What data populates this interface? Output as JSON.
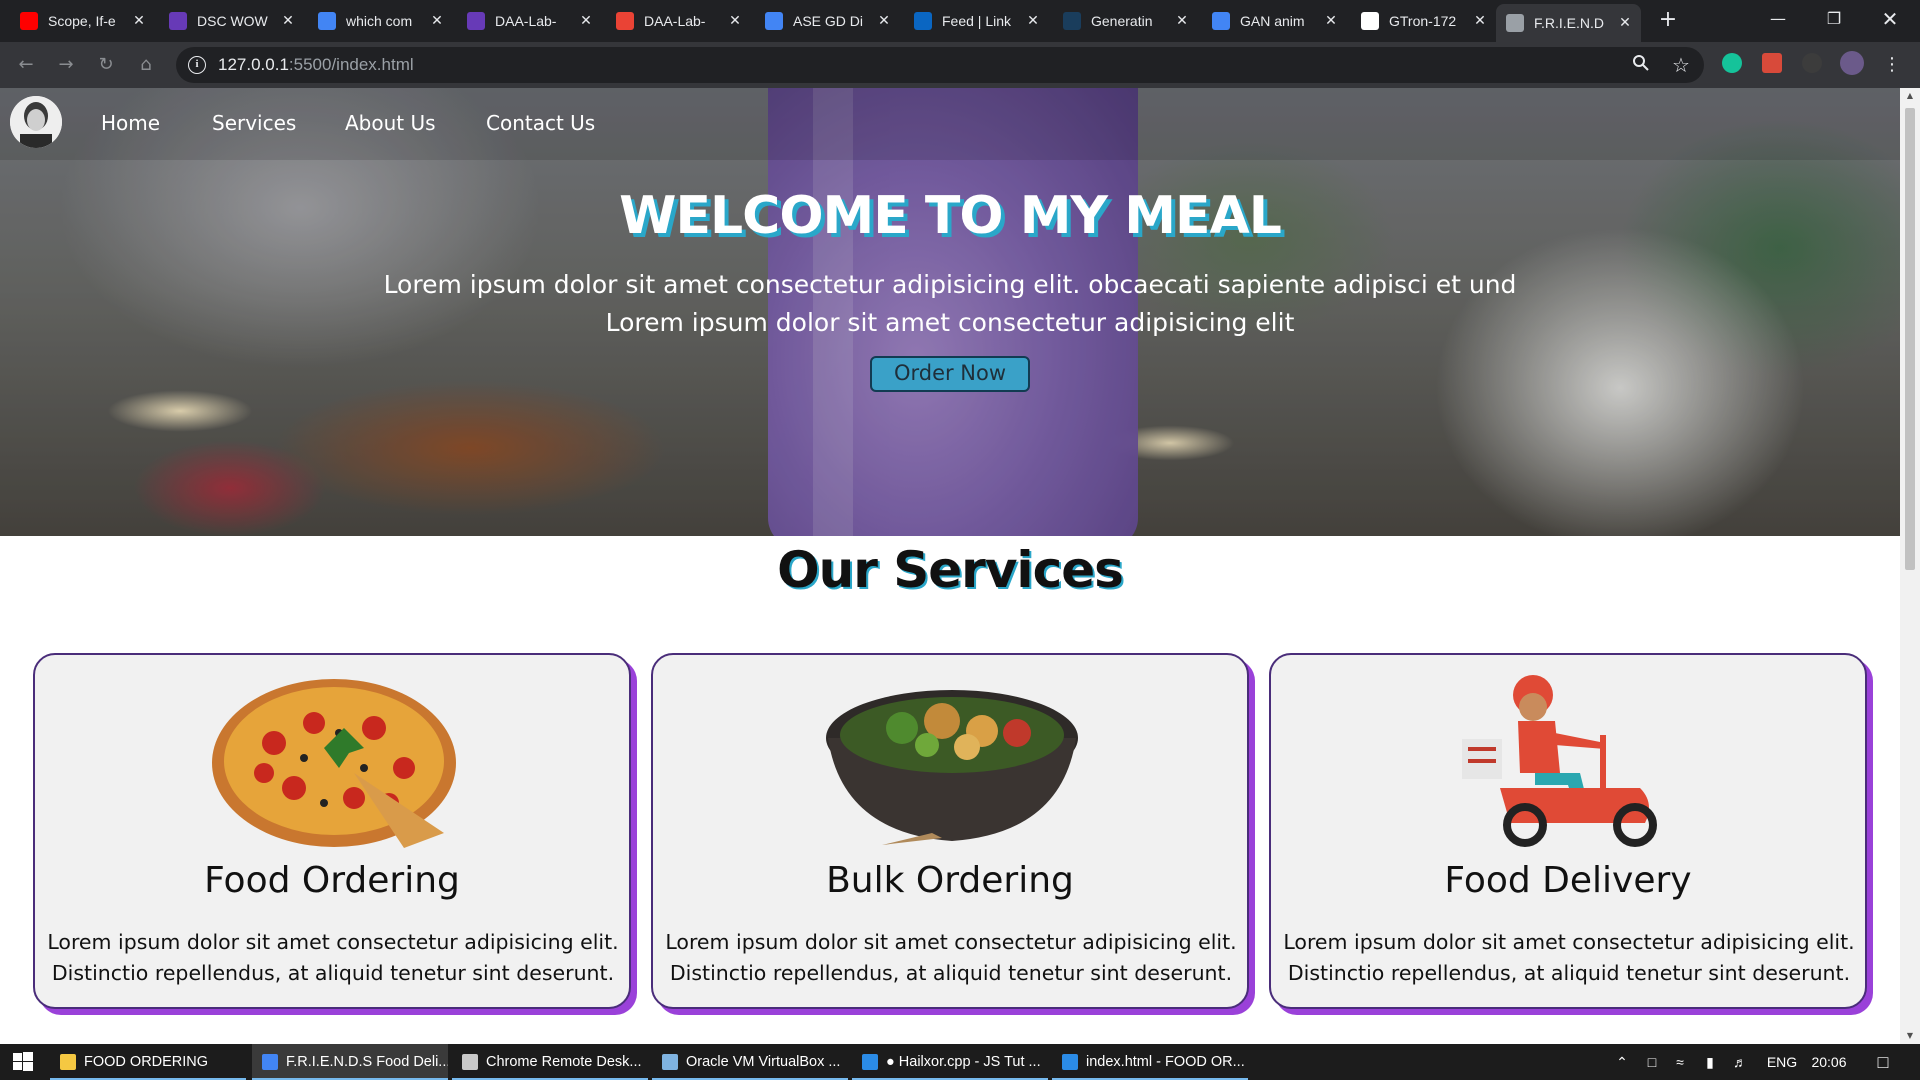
{
  "browser": {
    "tabs": [
      {
        "label": "Scope, If-e",
        "icon": "youtube-icon",
        "color": "#ff0000"
      },
      {
        "label": "DSC WOW",
        "icon": "forms-icon",
        "color": "#673ab7"
      },
      {
        "label": "which com",
        "icon": "google-icon",
        "color": "#4285f4"
      },
      {
        "label": "DAA-Lab-",
        "icon": "forms-icon",
        "color": "#673ab7"
      },
      {
        "label": "DAA-Lab-",
        "icon": "gmail-icon",
        "color": "#ea4335"
      },
      {
        "label": "ASE GD Di",
        "icon": "docs-icon",
        "color": "#4285f4"
      },
      {
        "label": "Feed | Link",
        "icon": "linkedin-icon",
        "color": "#0a66c2"
      },
      {
        "label": "Generatin",
        "icon": "tds-icon",
        "color": "#1a3d5c"
      },
      {
        "label": "GAN anim",
        "icon": "google-icon",
        "color": "#4285f4"
      },
      {
        "label": "GTron-172",
        "icon": "github-icon",
        "color": "#ffffff"
      },
      {
        "label": "F.R.I.E.N.D",
        "icon": "globe-icon",
        "color": "#9aa0a6"
      }
    ],
    "url_host": "127.0.0.1",
    "url_path": ":5500/index.html"
  },
  "site": {
    "nav": [
      "Home",
      "Services",
      "About Us",
      "Contact Us"
    ],
    "hero": {
      "title": "WELCOME TO MY MEAL",
      "line1": "Lorem ipsum dolor sit amet consectetur adipisicing elit. obcaecati sapiente adipisci et und",
      "line2": "Lorem ipsum dolor sit amet consectetur adipisicing elit",
      "button": "Order Now"
    },
    "services_title": "Our Services",
    "cards": [
      {
        "title": "Food Ordering",
        "desc1": "Lorem ipsum dolor sit amet consectetur adipisicing elit.",
        "desc2": "Distinctio repellendus, at aliquid tenetur sint deserunt.",
        "image": "pizza-image"
      },
      {
        "title": "Bulk Ordering",
        "desc1": "Lorem ipsum dolor sit amet consectetur adipisicing elit.",
        "desc2": "Distinctio repellendus, at aliquid tenetur sint deserunt.",
        "image": "salad-bowl-image"
      },
      {
        "title": "Food Delivery",
        "desc1": "Lorem ipsum dolor sit amet consectetur adipisicing elit.",
        "desc2": "Distinctio repellendus, at aliquid tenetur sint deserunt.",
        "image": "delivery-scooter-image"
      }
    ]
  },
  "taskbar": {
    "items": [
      {
        "label": "FOOD ORDERING",
        "icon": "folder-icon",
        "color": "#f5c842"
      },
      {
        "label": "F.R.I.E.N.D.S Food Deli...",
        "icon": "chrome-icon",
        "color": "#4285f4"
      },
      {
        "label": "Chrome Remote Desk...",
        "icon": "remote-desktop-icon",
        "color": "#c8c8c8"
      },
      {
        "label": "Oracle VM VirtualBox ...",
        "icon": "virtualbox-icon",
        "color": "#7fb3e0"
      },
      {
        "label": "● Hailxor.cpp - JS Tut ...",
        "icon": "vscode-icon",
        "color": "#2b8be6"
      },
      {
        "label": "index.html - FOOD OR...",
        "icon": "vscode-icon",
        "color": "#2b8be6"
      }
    ],
    "language": "ENG",
    "time": "20:06"
  }
}
